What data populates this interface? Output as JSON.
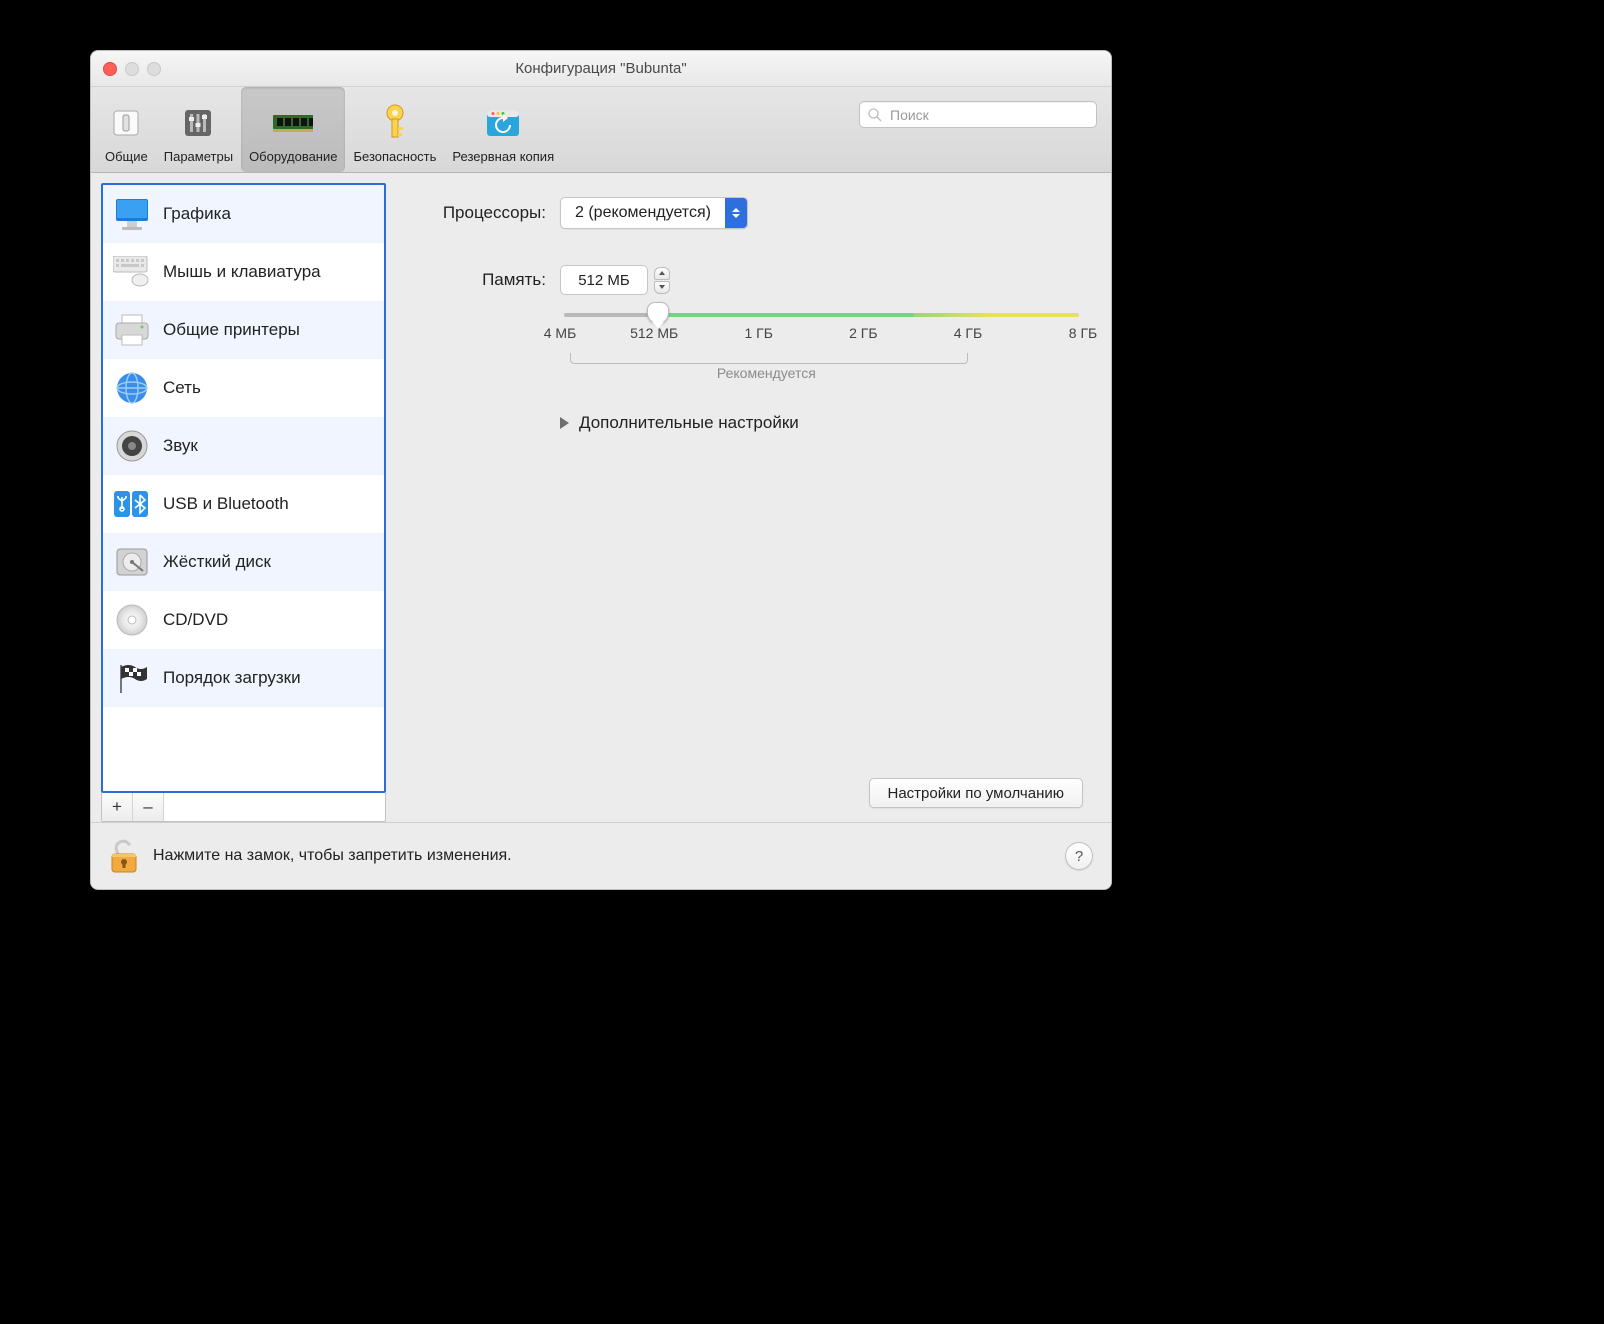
{
  "window": {
    "title": "Конфигурация \"Bubunta\""
  },
  "toolbar": {
    "items": [
      {
        "name": "general",
        "label": "Общие"
      },
      {
        "name": "options",
        "label": "Параметры"
      },
      {
        "name": "hardware",
        "label": "Оборудование",
        "active": true
      },
      {
        "name": "security",
        "label": "Безопасность"
      },
      {
        "name": "backup",
        "label": "Резервная копия"
      }
    ],
    "search_placeholder": "Поиск"
  },
  "sidebar": {
    "items": [
      {
        "name": "graphics",
        "label": "Графика"
      },
      {
        "name": "mouse-keyboard",
        "label": "Мышь и клавиатура"
      },
      {
        "name": "printers",
        "label": "Общие принтеры"
      },
      {
        "name": "network",
        "label": "Сеть"
      },
      {
        "name": "sound",
        "label": "Звук"
      },
      {
        "name": "usb-bluetooth",
        "label": "USB и Bluetooth"
      },
      {
        "name": "harddisk",
        "label": "Жёсткий диск"
      },
      {
        "name": "cddvd",
        "label": "CD/DVD"
      },
      {
        "name": "boot-order",
        "label": "Порядок загрузки"
      }
    ],
    "add": "+",
    "remove": "–"
  },
  "main": {
    "processors": {
      "label": "Процессоры:",
      "value": "2 (рекомендуется)"
    },
    "memory": {
      "label": "Память:",
      "value": "512 МБ"
    },
    "slider": {
      "ticks": [
        "4 МБ",
        "512 МБ",
        "1 ГБ",
        "2 ГБ",
        "4 ГБ",
        "8 ГБ"
      ],
      "thumb_percent": 18,
      "recommended_label": "Рекомендуется",
      "recommended_start_percent": 2,
      "recommended_end_percent": 78
    },
    "advanced": "Дополнительные настройки",
    "defaults_button": "Настройки по умолчанию"
  },
  "footer": {
    "lock_text": "Нажмите на замок, чтобы запретить изменения.",
    "help": "?"
  }
}
